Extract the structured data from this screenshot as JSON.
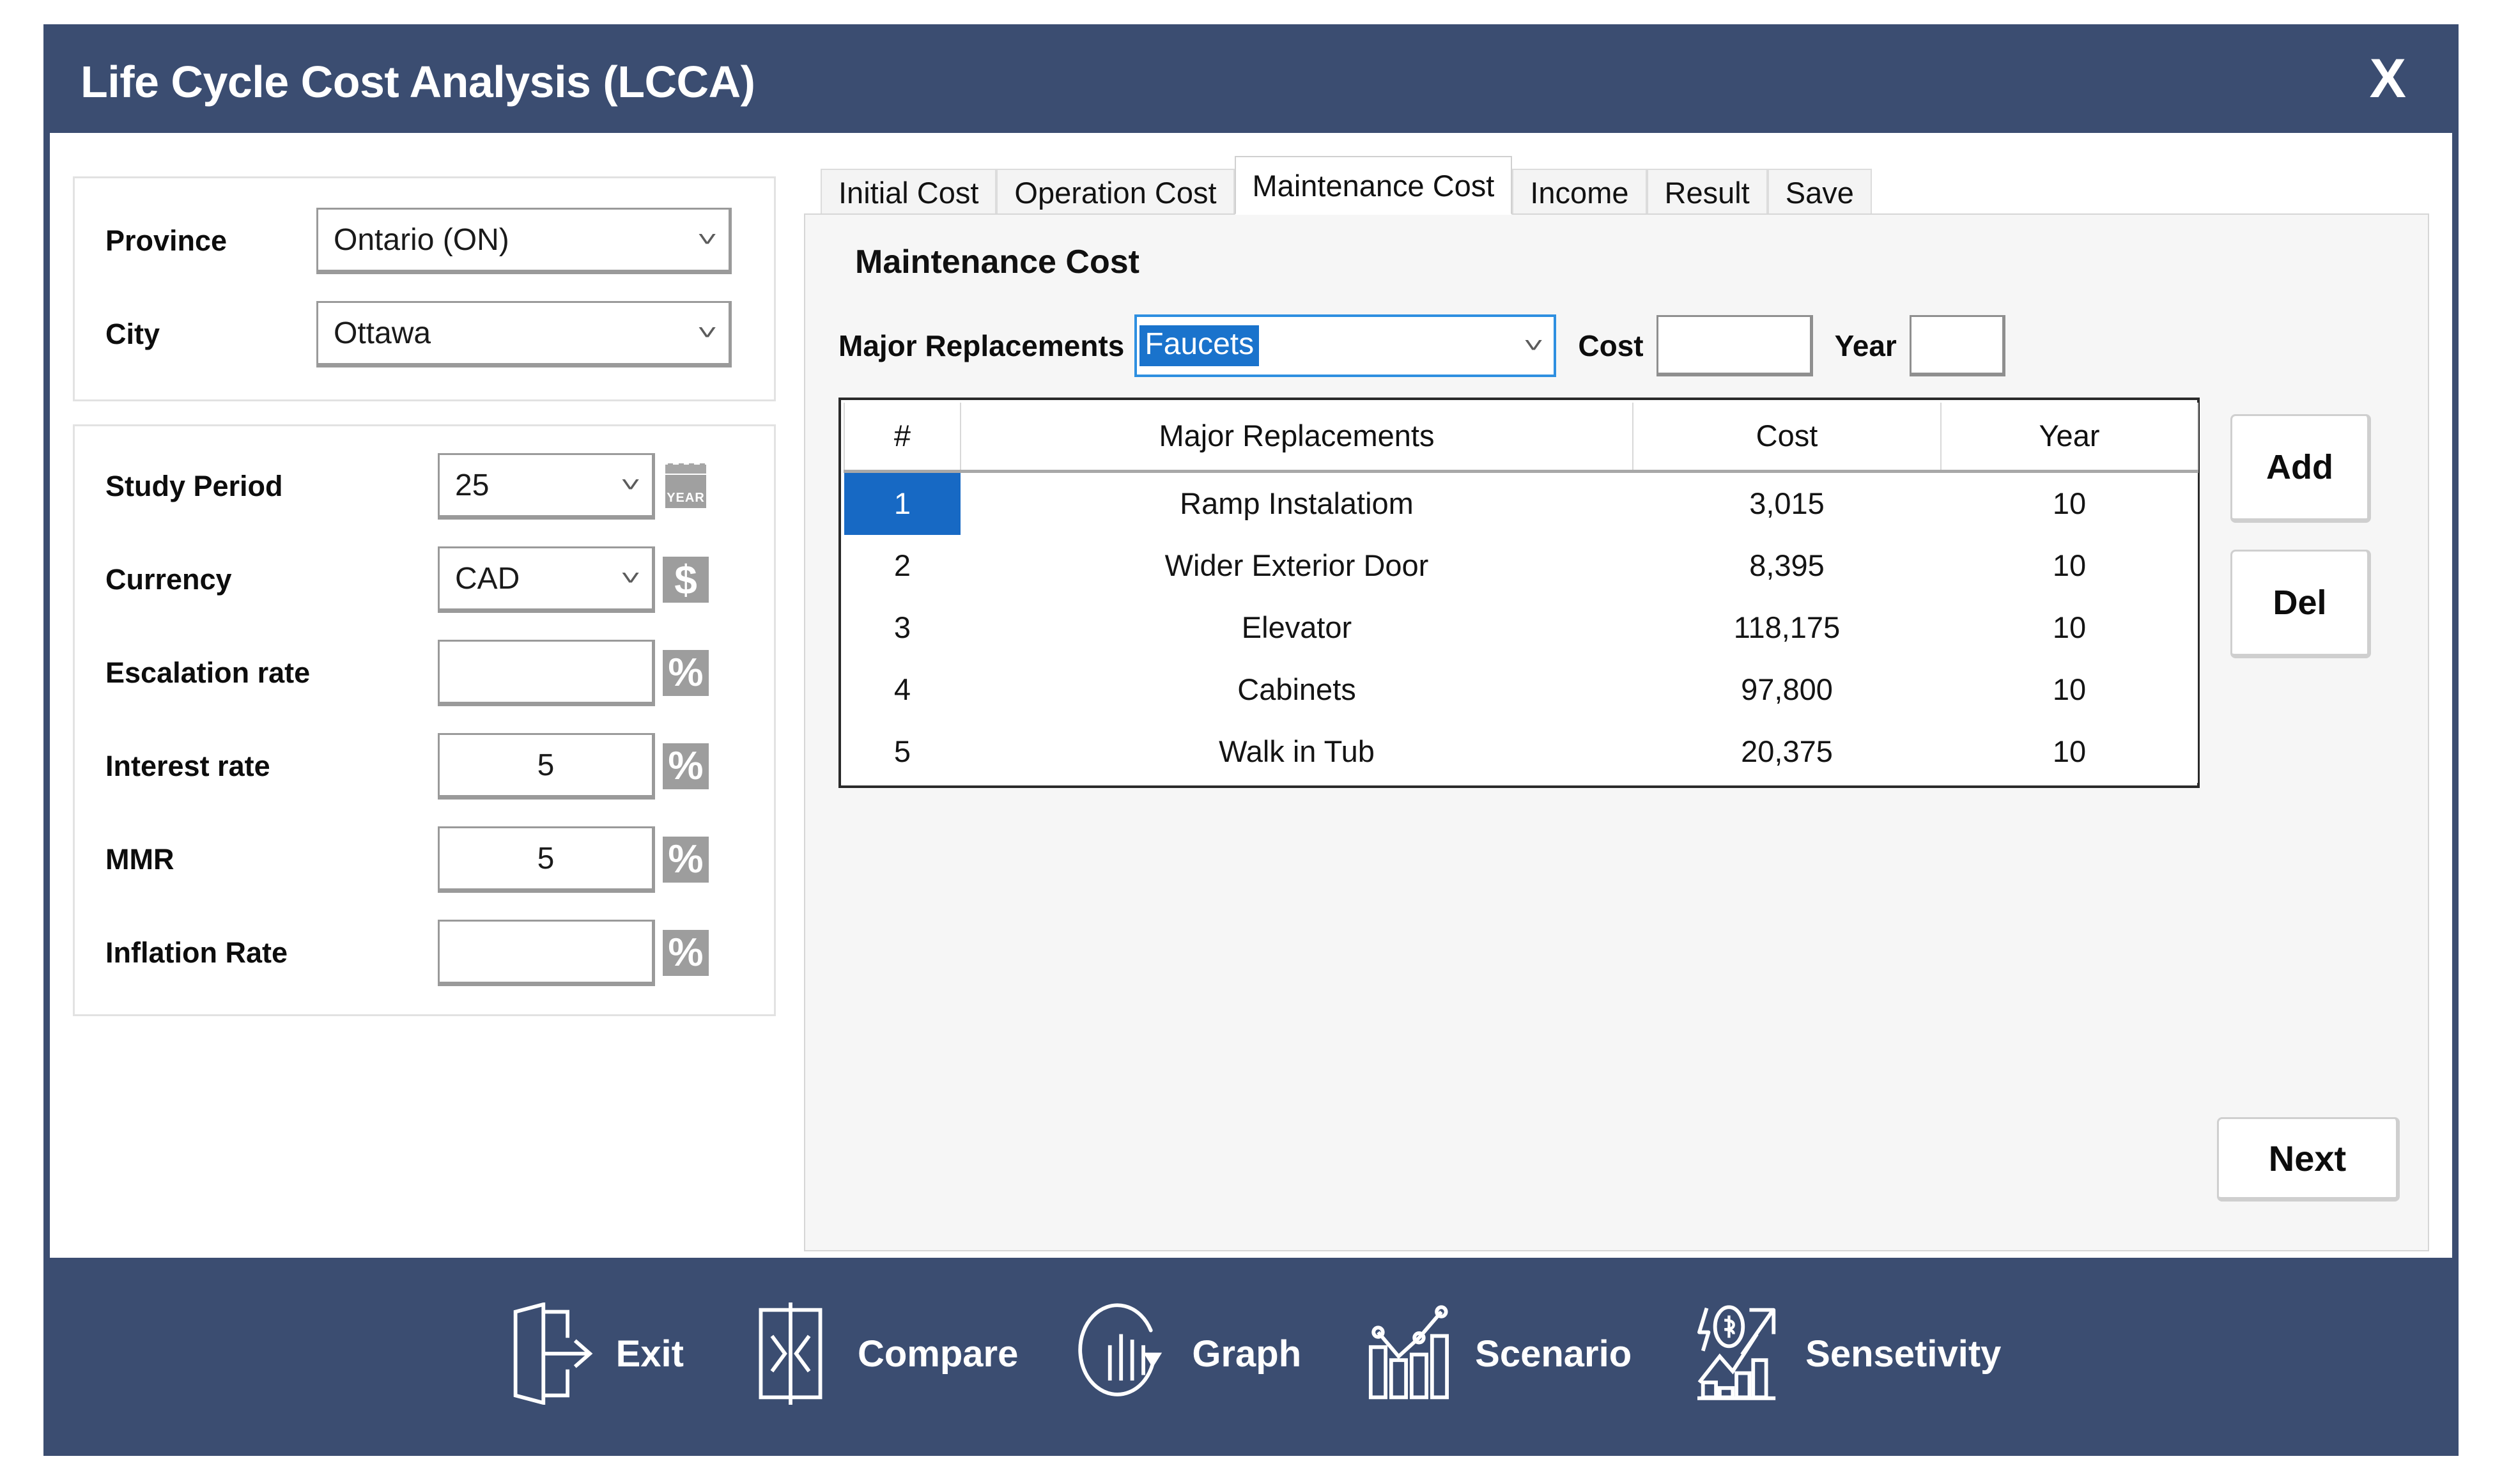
{
  "window": {
    "title": "Life Cycle Cost Analysis (LCCA)",
    "close_label": "X",
    "accent_color": "#3b4d71",
    "selection_color": "#1769c4",
    "focus_color": "#2e8fe0"
  },
  "location_panel": {
    "province": {
      "label": "Province",
      "value": "Ontario (ON)"
    },
    "city": {
      "label": "City",
      "value": "Ottawa"
    }
  },
  "parameters_panel": {
    "study_period": {
      "label": "Study Period",
      "value": "25",
      "unit_icon": "calendar-year-icon",
      "unit_text": "YEAR"
    },
    "currency": {
      "label": "Currency",
      "value": "CAD",
      "unit_icon": "dollar-icon",
      "unit_text": "$"
    },
    "escalation_rate": {
      "label": "Escalation rate",
      "value": "",
      "unit_icon": "percent-icon",
      "unit_text": "%"
    },
    "interest_rate": {
      "label": "Interest rate",
      "value": "5",
      "unit_icon": "percent-icon",
      "unit_text": "%"
    },
    "mmr": {
      "label": "MMR",
      "value": "5",
      "unit_icon": "percent-icon",
      "unit_text": "%"
    },
    "inflation_rate": {
      "label": "Inflation Rate",
      "value": "",
      "unit_icon": "percent-icon",
      "unit_text": "%"
    }
  },
  "tabs": [
    {
      "label": "Initial Cost",
      "active": false
    },
    {
      "label": "Operation Cost",
      "active": false
    },
    {
      "label": "Maintenance Cost",
      "active": true
    },
    {
      "label": "Income",
      "active": false
    },
    {
      "label": "Result",
      "active": false
    },
    {
      "label": "Save",
      "active": false
    }
  ],
  "maintenance": {
    "heading": "Maintenance Cost",
    "major_replacements_label": "Major Replacements",
    "major_replacements_value": "Faucets",
    "cost_label": "Cost",
    "cost_value": "",
    "year_label": "Year",
    "year_value": "",
    "add_label": "Add",
    "del_label": "Del",
    "next_label": "Next"
  },
  "table": {
    "headers": [
      "#",
      "Major Replacements",
      "Cost",
      "Year"
    ],
    "selected_row_index": 0,
    "rows": [
      {
        "num": "1",
        "name": "Ramp Instalatiom",
        "cost": "3,015",
        "year": "10"
      },
      {
        "num": "2",
        "name": "Wider Exterior Door",
        "cost": "8,395",
        "year": "10"
      },
      {
        "num": "3",
        "name": "Elevator",
        "cost": "118,175",
        "year": "10"
      },
      {
        "num": "4",
        "name": "Cabinets",
        "cost": "97,800",
        "year": "10"
      },
      {
        "num": "5",
        "name": "Walk in Tub",
        "cost": "20,375",
        "year": "10"
      }
    ]
  },
  "toolbar": [
    {
      "label": "Exit",
      "icon": "exit-door-icon"
    },
    {
      "label": "Compare",
      "icon": "compare-icon"
    },
    {
      "label": "Graph",
      "icon": "graph-refresh-icon"
    },
    {
      "label": "Scenario",
      "icon": "scenario-chart-icon"
    },
    {
      "label": "Sensetivity",
      "icon": "sensitivity-icon"
    }
  ]
}
